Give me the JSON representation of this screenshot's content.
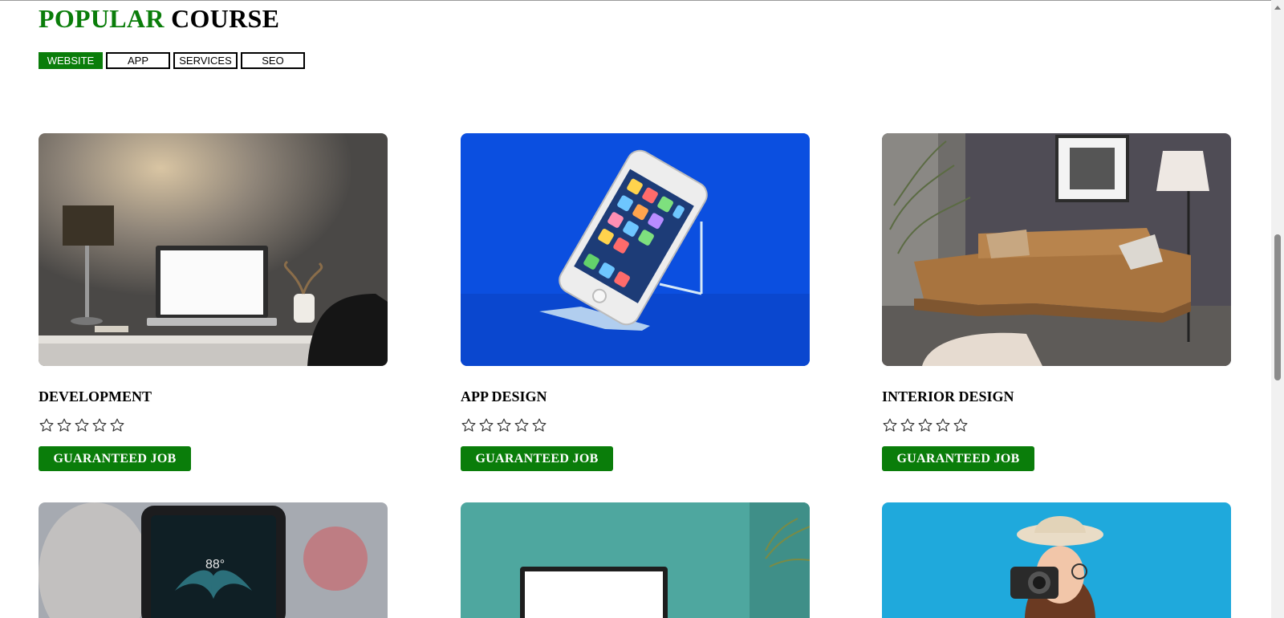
{
  "header": {
    "title_accent": "POPULAR",
    "title_rest": "COURSE"
  },
  "tabs": [
    {
      "label": "WEBSITE",
      "active": true
    },
    {
      "label": "APP",
      "active": false
    },
    {
      "label": "SERVICES",
      "active": false
    },
    {
      "label": "SEO",
      "active": false
    }
  ],
  "courses": [
    {
      "title": "DEVELOPMENT",
      "image": "laptop-desk-lamp-photo",
      "rating": 0,
      "max_rating": 5,
      "button": "GUARANTEED JOB"
    },
    {
      "title": "APP DESIGN",
      "image": "smartphone-on-stand-photo",
      "rating": 0,
      "max_rating": 5,
      "button": "GUARANTEED JOB"
    },
    {
      "title": "INTERIOR DESIGN",
      "image": "leather-sofa-living-room-photo",
      "rating": 0,
      "max_rating": 5,
      "button": "GUARANTEED JOB"
    }
  ],
  "more_courses": [
    {
      "image": "foldable-phone-photo"
    },
    {
      "image": "laptop-teal-background-photo"
    },
    {
      "image": "woman-with-camera-photo"
    }
  ],
  "colors": {
    "brand_green": "#0a7d0a",
    "tab_border": "#000000",
    "page_background": "#ffffff"
  }
}
